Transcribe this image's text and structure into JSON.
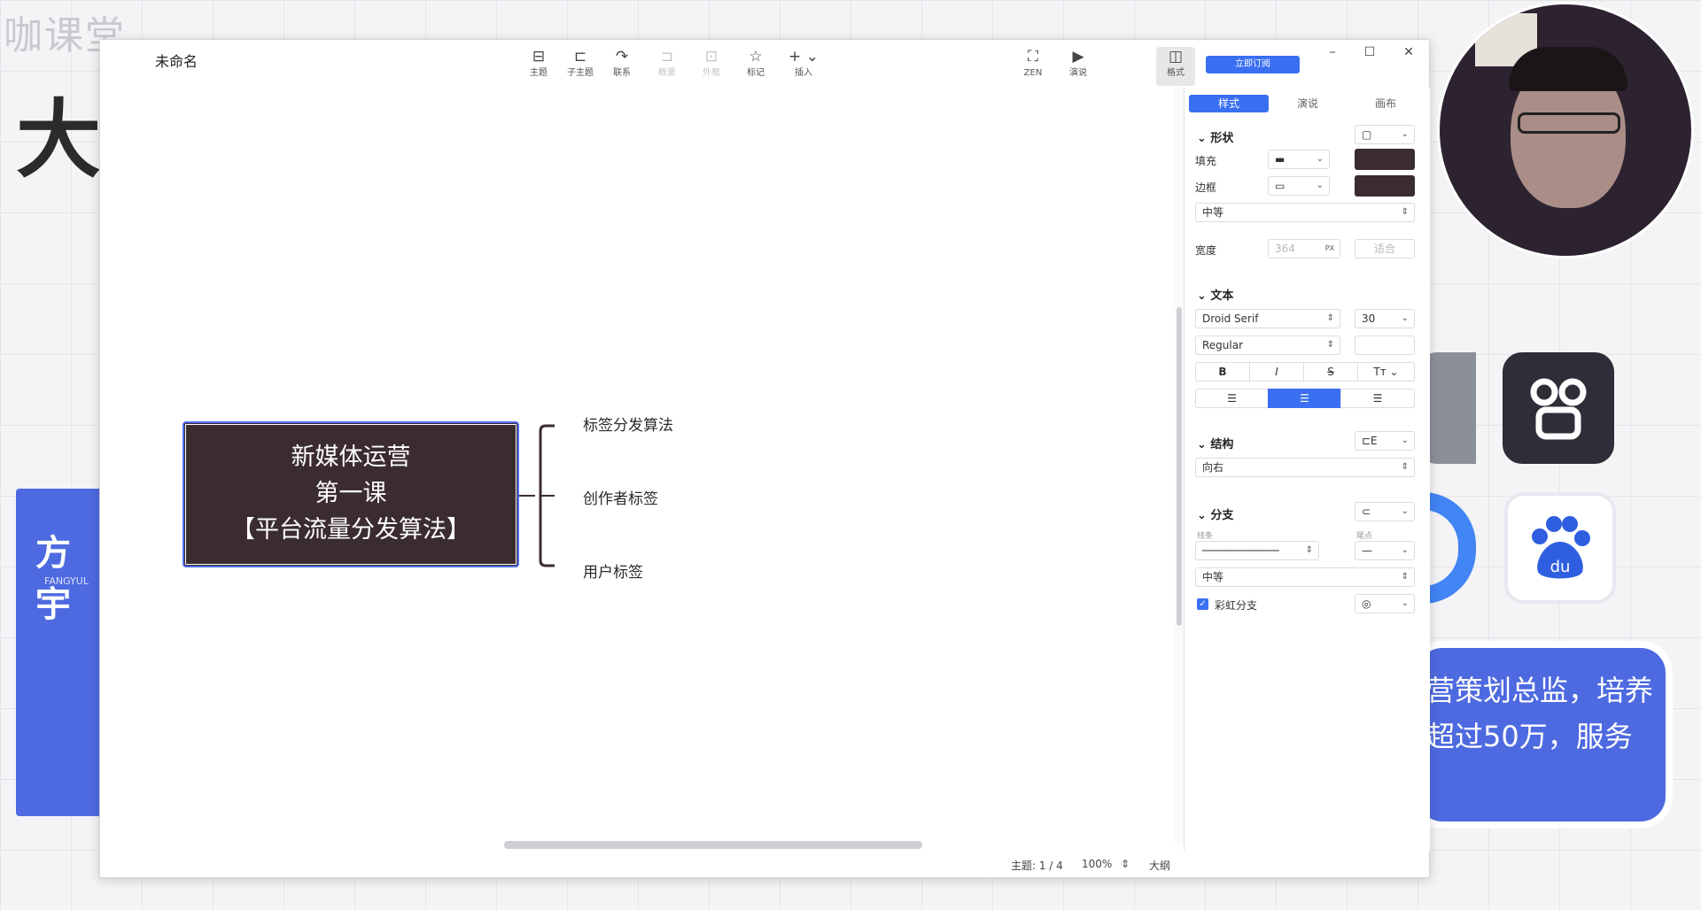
{
  "background": {
    "watermark": "咖课堂",
    "big_char": "大",
    "left_card": {
      "title": "方宇",
      "subtitle": "FANGYUL"
    },
    "right_card_lines": [
      "营策划总监，培养",
      "超过50万，服务"
    ],
    "baidu_text": "du"
  },
  "app": {
    "doc_title": "未命名",
    "toolbar": [
      {
        "icon": "topic-icon",
        "glyph": "⊟",
        "label": "主题",
        "enabled": true
      },
      {
        "icon": "subtopic-icon",
        "glyph": "⊏",
        "label": "子主题",
        "enabled": true
      },
      {
        "icon": "relationship-icon",
        "glyph": "↷",
        "label": "联系",
        "enabled": true
      },
      {
        "icon": "summary-icon",
        "glyph": "⊐",
        "label": "概要",
        "enabled": false
      },
      {
        "icon": "boundary-icon",
        "glyph": "⊡",
        "label": "外框",
        "enabled": false
      },
      {
        "icon": "marker-icon",
        "glyph": "☆",
        "label": "标记",
        "enabled": true
      },
      {
        "icon": "insert-icon",
        "glyph": "+ ⌄",
        "label": "插入",
        "enabled": true
      },
      {
        "icon": "zen-icon",
        "glyph": "⛶",
        "label": "ZEN",
        "enabled": true
      },
      {
        "icon": "pitch-icon",
        "glyph": "▶",
        "label": "演说",
        "enabled": true
      },
      {
        "icon": "format-panel-icon",
        "glyph": "◫",
        "label": "格式",
        "enabled": true
      }
    ],
    "subscribe_label": "立即订阅",
    "window_controls": {
      "minimize": "–",
      "maximize": "☐",
      "close": "✕"
    },
    "mindmap": {
      "central_topic": [
        "新媒体运营",
        "第一课",
        "【平台流量分发算法】"
      ],
      "subtopics": [
        "标签分发算法",
        "创作者标签",
        "用户标签"
      ]
    },
    "statusbar": {
      "topics": "主题: 1 / 4",
      "zoom": "100%",
      "outline": "大纲"
    }
  },
  "panel": {
    "tabs": [
      "样式",
      "演说",
      "画布"
    ],
    "shape": {
      "title": "形状",
      "shape_value": "▢"
    },
    "fill": {
      "label": "填充",
      "color": "#3b2c30"
    },
    "border": {
      "label": "边框",
      "color": "#3b2c30",
      "weight": "中等"
    },
    "width": {
      "label": "宽度",
      "value": "364",
      "unit": "PX",
      "fit": "适合"
    },
    "text": {
      "title": "文本",
      "font": "Droid Serif",
      "size": "30",
      "weight": "Regular",
      "styles": [
        "B",
        "I",
        "S",
        "Tт"
      ],
      "align": [
        "left",
        "center",
        "right"
      ]
    },
    "structure": {
      "title": "结构",
      "value": "向右"
    },
    "branch": {
      "title": "分支",
      "line_label": "线条",
      "end_label": "尾点",
      "weight": "中等",
      "rainbow_label": "彩虹分支",
      "rainbow_checked": true
    },
    "accent": "#3a6ff2"
  }
}
